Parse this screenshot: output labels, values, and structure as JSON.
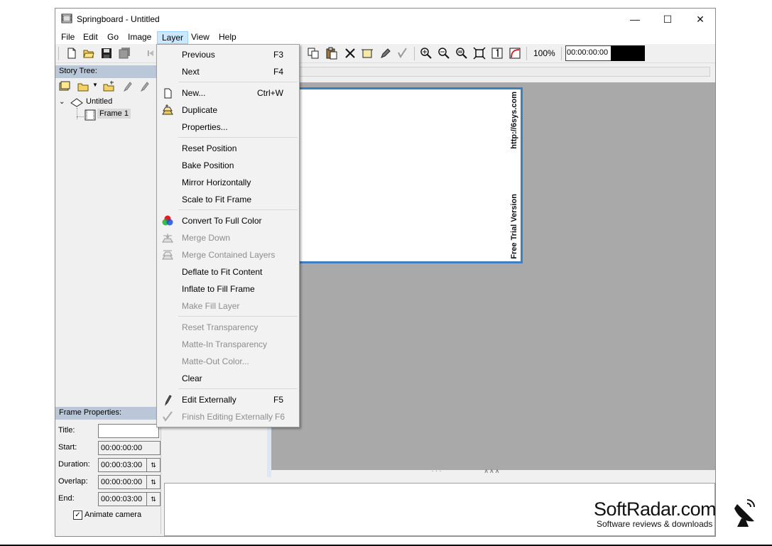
{
  "window": {
    "title": "Springboard - Untitled",
    "minimize": "—",
    "maximize": "☐",
    "close": "✕"
  },
  "menubar": {
    "items": [
      "File",
      "Edit",
      "Go",
      "Image",
      "Layer",
      "View",
      "Help"
    ],
    "active": "Layer"
  },
  "toolbar": {
    "zoom": "100%",
    "timecode": "00:00:00:00"
  },
  "story_tree": {
    "header": "Story Tree:",
    "root": "Untitled",
    "child": "Frame 1"
  },
  "frame_properties": {
    "header": "Frame Properties:",
    "title_label": "Title:",
    "title_value": "",
    "start_label": "Start:",
    "start_value": "00:00:00:00",
    "duration_label": "Duration:",
    "duration_value": "00:00:03:00",
    "overlap_label": "Overlap:",
    "overlap_value": "00:00:00:00",
    "end_label": "End:",
    "end_value": "00:00:03:00",
    "animate_label": "Animate camera",
    "animate_checked": true
  },
  "canvas": {
    "text_top": "http://6sys.com",
    "text_bottom": "Free Trial Version"
  },
  "layer_menu": {
    "items": [
      {
        "label": "Previous",
        "key": "F3",
        "enabled": true,
        "icon": ""
      },
      {
        "label": "Next",
        "key": "F4",
        "enabled": true,
        "icon": ""
      },
      {
        "label": "New...",
        "key": "Ctrl+W",
        "enabled": true,
        "icon": "new-page-icon"
      },
      {
        "label": "Duplicate",
        "key": "",
        "enabled": true,
        "icon": "duplicate-layer-icon"
      },
      {
        "label": "Properties...",
        "key": "",
        "enabled": true,
        "icon": ""
      },
      {
        "label": "Reset Position",
        "key": "",
        "enabled": true,
        "icon": ""
      },
      {
        "label": "Bake Position",
        "key": "",
        "enabled": true,
        "icon": ""
      },
      {
        "label": "Mirror Horizontally",
        "key": "",
        "enabled": true,
        "icon": ""
      },
      {
        "label": "Scale to Fit Frame",
        "key": "",
        "enabled": true,
        "icon": ""
      },
      {
        "label": "Convert To Full Color",
        "key": "",
        "enabled": true,
        "icon": "rgb-circles-icon"
      },
      {
        "label": "Merge Down",
        "key": "",
        "enabled": false,
        "icon": "merge-down-icon"
      },
      {
        "label": "Merge Contained Layers",
        "key": "",
        "enabled": false,
        "icon": "merge-layers-icon"
      },
      {
        "label": "Deflate to Fit Content",
        "key": "",
        "enabled": true,
        "icon": ""
      },
      {
        "label": "Inflate to Fill Frame",
        "key": "",
        "enabled": true,
        "icon": ""
      },
      {
        "label": "Make Fill Layer",
        "key": "",
        "enabled": false,
        "icon": ""
      },
      {
        "label": "Reset Transparency",
        "key": "",
        "enabled": false,
        "icon": ""
      },
      {
        "label": "Matte-In Transparency",
        "key": "",
        "enabled": false,
        "icon": ""
      },
      {
        "label": "Matte-Out Color...",
        "key": "",
        "enabled": false,
        "icon": ""
      },
      {
        "label": "Clear",
        "key": "",
        "enabled": true,
        "icon": ""
      },
      {
        "label": "Edit Externally",
        "key": "F5",
        "enabled": true,
        "icon": "pencil-icon"
      },
      {
        "label": "Finish Editing Externally",
        "key": "F6",
        "enabled": false,
        "icon": "finish-edit-icon"
      }
    ]
  },
  "watermark": {
    "main": "SoftRadar.com",
    "sub": "Software reviews & downloads"
  }
}
